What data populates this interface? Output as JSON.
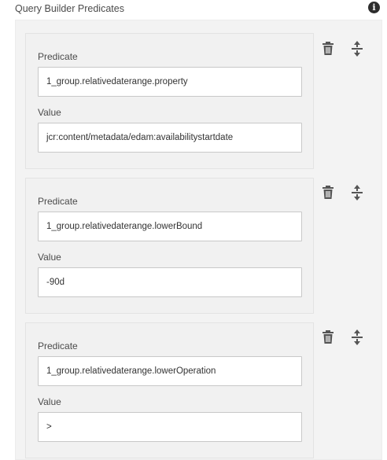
{
  "header": {
    "title": "Query Builder Predicates",
    "info_icon": "info-icon"
  },
  "labels": {
    "predicate": "Predicate",
    "value": "Value"
  },
  "predicates": [
    {
      "predicate": "1_group.relativedaterange.property",
      "value": "jcr:content/metadata/edam:availabilitystartdate"
    },
    {
      "predicate": "1_group.relativedaterange.lowerBound",
      "value": "-90d"
    },
    {
      "predicate": "1_group.relativedaterange.lowerOperation",
      "value": ">"
    }
  ],
  "item_actions": [
    "trash-icon",
    "reorder-icon"
  ],
  "colors": {
    "panel_bg": "#f3f3f3",
    "item_bg": "#f1f1f1",
    "input_border": "#c8c8c8",
    "icon": "#555555"
  }
}
